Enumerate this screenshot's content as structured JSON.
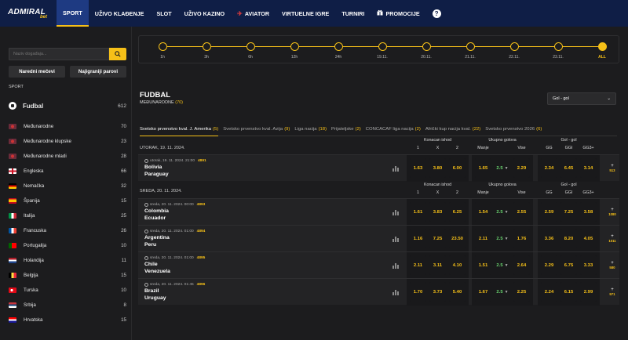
{
  "nav": {
    "logo_main": "ADMIRAL",
    "logo_sub": "bet",
    "items": [
      {
        "label": "SPORT",
        "active": true
      },
      {
        "label": "UŽIVO KLAĐENJE"
      },
      {
        "label": "SLOT"
      },
      {
        "label": "UŽIVO KAZINO"
      },
      {
        "label": "AVIATOR",
        "icon": "plane-icon"
      },
      {
        "label": "VIRTUELNE IGRE"
      },
      {
        "label": "TURNIRI"
      },
      {
        "label": "PROMOCIJE",
        "icon": "gift-icon"
      }
    ],
    "help": "?"
  },
  "sidebar": {
    "search_placeholder": "Naziv događaja...",
    "btn_next": "Naredni mečevi",
    "btn_top": "Najigraniji parovi",
    "sport_label": "SPORT",
    "sport_name": "Fudbal",
    "sport_count": "612",
    "leagues": [
      {
        "name": "Međunarodne",
        "count": "70",
        "flag": "world"
      },
      {
        "name": "Međunarodne klupske",
        "count": "23",
        "flag": "world"
      },
      {
        "name": "Međunarodne mladi",
        "count": "28",
        "flag": "world"
      },
      {
        "name": "Engleska",
        "count": "66",
        "flag": "england"
      },
      {
        "name": "Nemačka",
        "count": "32",
        "flag": "germany"
      },
      {
        "name": "Španija",
        "count": "15",
        "flag": "spain"
      },
      {
        "name": "Italija",
        "count": "25",
        "flag": "italy"
      },
      {
        "name": "Francuska",
        "count": "26",
        "flag": "france"
      },
      {
        "name": "Portugalija",
        "count": "10",
        "flag": "portugal"
      },
      {
        "name": "Holandija",
        "count": "11",
        "flag": "netherlands"
      },
      {
        "name": "Belgija",
        "count": "15",
        "flag": "belgium"
      },
      {
        "name": "Turska",
        "count": "10",
        "flag": "turkey"
      },
      {
        "name": "Srbija",
        "count": "8",
        "flag": "serbia"
      },
      {
        "name": "Hrvatska",
        "count": "15",
        "flag": "croatia"
      }
    ]
  },
  "timeline": {
    "labels": [
      "1h",
      "3h",
      "6h",
      "12h",
      "24h",
      "19.11.",
      "20.11.",
      "21.11.",
      "22.11.",
      "23.11.",
      "ALL"
    ],
    "active_index": 10
  },
  "panel": {
    "title": "FUDBAL",
    "subtitle": "MEĐUNARODNE",
    "subtitle_count": "(70)",
    "market": "Gol - gol",
    "tabs": [
      {
        "label": "Svetsko prvenstvo kval. J. Amerika",
        "count": "(5)",
        "active": true
      },
      {
        "label": "Svetsko prvenstvo kval. Azija",
        "count": "(9)"
      },
      {
        "label": "Liga nacija",
        "count": "(18)"
      },
      {
        "label": "Prijateljske",
        "count": "(2)"
      },
      {
        "label": "CONCACAF liga nacija",
        "count": "(2)"
      },
      {
        "label": "Afrički kup nacija kval.",
        "count": "(22)"
      },
      {
        "label": "Svetsko prvenstvo 2026",
        "count": "(6)"
      }
    ],
    "headers": {
      "konacan": "Konacan ishod",
      "ukupno": "Ukupno golova",
      "gg": "Gol - gol",
      "k1": "1",
      "kx": "X",
      "k2": "2",
      "manje": "Manje",
      "vise": "Vise",
      "g1": "GG",
      "g2": "GGI",
      "g3": "GG3+"
    },
    "sections": [
      {
        "date": "UTORAK, 19. 11. 2024.",
        "matches": [
          {
            "meta": "utorak, 19. 11. 2024. 21:00",
            "code": "4891",
            "home": "Bolivia",
            "away": "Paraguay",
            "o1": "1.63",
            "ox": "3.80",
            "o2": "6.00",
            "manje": "1.65",
            "line": "2.5",
            "vise": "2.29",
            "gg": "2.34",
            "ggi": "6.45",
            "gg3": "3.14",
            "more": "513"
          }
        ]
      },
      {
        "date": "SREDA, 20. 11. 2024.",
        "matches": [
          {
            "meta": "sreda, 20. 11. 2024. 00:00",
            "code": "4893",
            "home": "Colombia",
            "away": "Ecuador",
            "o1": "1.61",
            "ox": "3.83",
            "o2": "6.25",
            "manje": "1.54",
            "line": "2.5",
            "vise": "2.55",
            "gg": "2.59",
            "ggi": "7.25",
            "gg3": "3.58",
            "more": "1080"
          },
          {
            "meta": "sreda, 20. 11. 2024. 01:00",
            "code": "4894",
            "home": "Argentina",
            "away": "Peru",
            "o1": "1.16",
            "ox": "7.25",
            "o2": "23.50",
            "manje": "2.11",
            "line": "2.5",
            "vise": "1.76",
            "gg": "3.36",
            "ggi": "8.20",
            "gg3": "4.05",
            "more": "1011"
          },
          {
            "meta": "sreda, 20. 11. 2024. 01:00",
            "code": "4895",
            "home": "Chile",
            "away": "Venezuela",
            "o1": "2.11",
            "ox": "3.11",
            "o2": "4.10",
            "manje": "1.51",
            "line": "2.5",
            "vise": "2.64",
            "gg": "2.29",
            "ggi": "6.75",
            "gg3": "3.33",
            "more": "580"
          },
          {
            "meta": "sreda, 20. 11. 2024. 01:45",
            "code": "4896",
            "home": "Brazil",
            "away": "Uruguay",
            "o1": "1.70",
            "ox": "3.73",
            "o2": "5.40",
            "manje": "1.67",
            "line": "2.5",
            "vise": "2.25",
            "gg": "2.24",
            "ggi": "6.15",
            "gg3": "2.99",
            "more": "971"
          }
        ]
      }
    ]
  },
  "colors": {
    "accent": "#f6c018",
    "nav_bg": "#0f1e46",
    "green": "#69d36e"
  }
}
